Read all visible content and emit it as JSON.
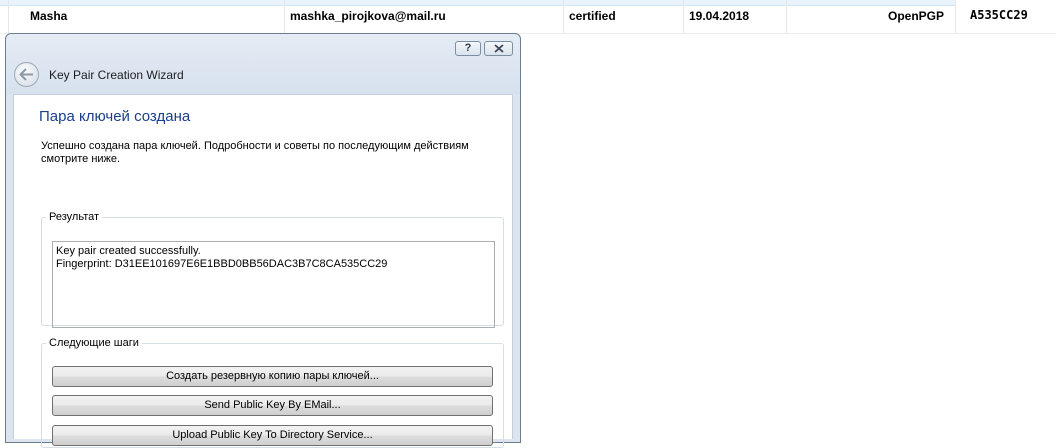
{
  "key_list": {
    "row": {
      "name": "Masha",
      "email": "mashka_pirojkova@mail.ru",
      "validity": "certified",
      "date": "19.04.2018",
      "protocol": "OpenPGP",
      "key_id": "A535CC29"
    }
  },
  "wizard": {
    "help_label": "?",
    "title": "Key Pair Creation Wizard",
    "heading": "Пара ключей создана",
    "description": "Успешно создана пара ключей. Подробности и советы по последующим действиям смотрите ниже.",
    "result": {
      "legend": "Результат",
      "line1": "Key pair created successfully.",
      "line2": "Fingerprint: D31EE101697E6E1BBD0BB56DAC3B7C8CA535CC29"
    },
    "next_steps": {
      "legend": "Следующие шаги",
      "backup_button": "Создать резервную копию пары ключей...",
      "email_button": "Send Public Key By EMail...",
      "upload_button": "Upload Public Key To Directory Service..."
    }
  },
  "colors": {
    "heading": "#1a3f8c",
    "window_frame": "#dce5ef"
  }
}
